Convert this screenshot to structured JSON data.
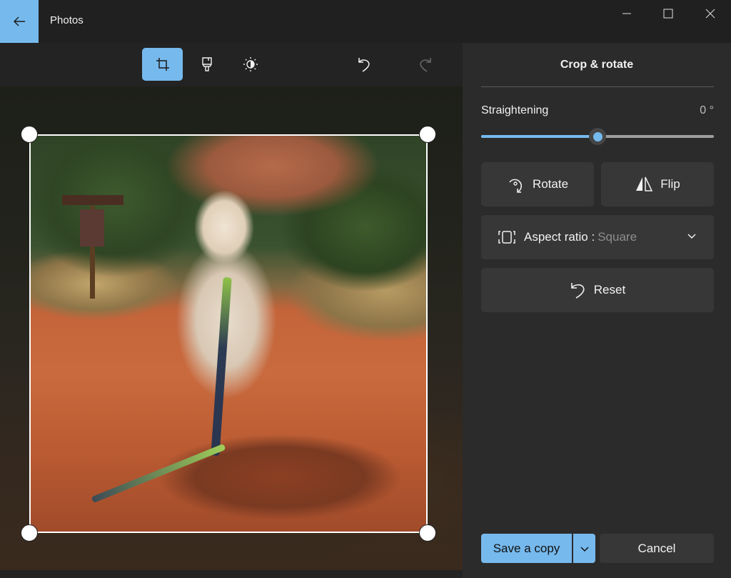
{
  "window": {
    "app_title": "Photos",
    "back_icon": "arrow-left-icon",
    "controls": [
      "minimize-icon",
      "maximize-icon",
      "close-icon"
    ]
  },
  "toolbar": {
    "tools": [
      {
        "name": "Crop",
        "icon": "crop-icon",
        "active": true
      },
      {
        "name": "Markup",
        "icon": "brush-icon",
        "active": false
      },
      {
        "name": "Adjustment",
        "icon": "brightness-icon",
        "active": false
      }
    ],
    "undo_icon": "undo-icon",
    "redo_icon": "redo-icon",
    "redo_enabled": false
  },
  "canvas": {
    "image_description": "White dog sitting on red dirt trail with green leash, trees and red rock behind",
    "crop_handles": [
      "top-left",
      "top-right",
      "bottom-left",
      "bottom-right"
    ]
  },
  "panel": {
    "title": "Crop & rotate",
    "straightening": {
      "label": "Straightening",
      "value_text": "0 °",
      "value": 0,
      "min": -45,
      "max": 45,
      "fraction": 0.5
    },
    "rotate_label": "Rotate",
    "flip_label": "Flip",
    "aspect_ratio": {
      "label": "Aspect ratio :",
      "selected": "Square"
    },
    "reset_label": "Reset",
    "save_label": "Save a copy",
    "cancel_label": "Cancel"
  },
  "colors": {
    "accent": "#76b9ed",
    "titlebar": "#202020",
    "canvas_bg": "#232323",
    "panel_bg": "#2b2b2b",
    "button_bg": "#373737"
  }
}
